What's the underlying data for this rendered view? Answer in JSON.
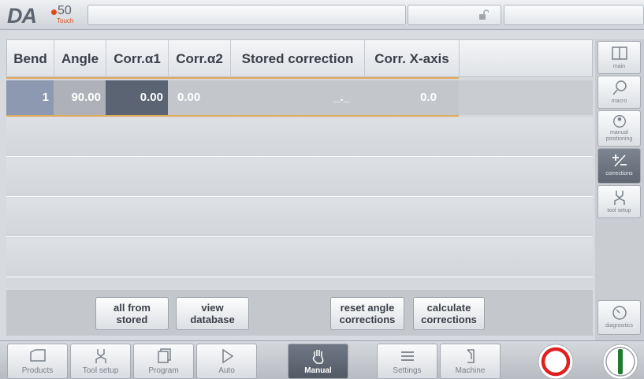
{
  "logo": {
    "brand": "DA",
    "model": "50",
    "edition": "Touch"
  },
  "table": {
    "headers": [
      "Bend",
      "Angle",
      "Corr.α1",
      "Corr.α2",
      "Stored correction",
      "Corr. X-axis"
    ],
    "rows": [
      {
        "bend": "1",
        "angle": "90.00",
        "corr_a1": "0.00",
        "corr_a2": "0.00",
        "stored": "_._",
        "corr_x": "0.0"
      }
    ]
  },
  "actions": {
    "all_from_stored": "all from\nstored",
    "view_database": "view\ndatabase",
    "reset_angle": "reset angle\ncorrections",
    "calculate": "calculate\ncorrections"
  },
  "side_menu": [
    {
      "label": "main",
      "icon": "main-panel-icon"
    },
    {
      "label": "macro",
      "icon": "magnifier-icon"
    },
    {
      "label": "manual\npositioning",
      "icon": "manual-positioning-icon"
    },
    {
      "label": "corrections",
      "icon": "plus-minus-icon",
      "active": true
    },
    {
      "label": "tool setup",
      "icon": "tool-icon"
    },
    {
      "label": "diagnostics",
      "icon": "gauge-icon"
    }
  ],
  "nav": [
    {
      "label": "Products",
      "icon": "products-icon"
    },
    {
      "label": "Tool setup",
      "icon": "tool-setup-icon"
    },
    {
      "label": "Program",
      "icon": "program-icon"
    },
    {
      "label": "Auto",
      "icon": "play-icon"
    },
    {
      "label": "Manual",
      "icon": "hand-icon",
      "active": true
    },
    {
      "label": "Settings",
      "icon": "settings-icon"
    },
    {
      "label": "Machine",
      "icon": "machine-icon"
    }
  ],
  "colors": {
    "accent_orange": "#e3a95a",
    "bend_cell": "#8c99b0",
    "angle_cell": "#aeb2b8",
    "corr1_cell": "#5a6472",
    "stop_red": "#e02020",
    "start_green": "#1e7a2e"
  }
}
